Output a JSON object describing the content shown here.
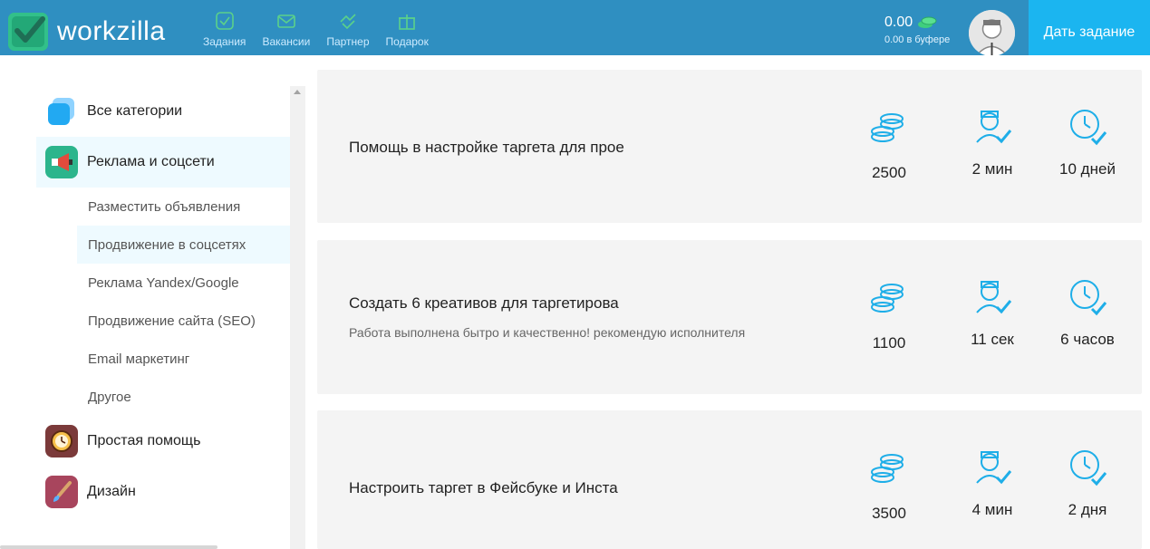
{
  "header": {
    "brand": "workzilla",
    "nav": [
      {
        "label": "Задания",
        "icon": "tasks-icon"
      },
      {
        "label": "Вакансии",
        "icon": "vacancies-icon"
      },
      {
        "label": "Партнер",
        "icon": "partner-icon"
      },
      {
        "label": "Подарок",
        "icon": "gift-icon"
      }
    ],
    "balance": "0.00",
    "balance_sub": "0.00 в буфере",
    "cta": "Дать задание"
  },
  "sidebar": {
    "categories": [
      {
        "label": "Все категории",
        "icon": "all-categories-icon",
        "color": "#3aa7f5"
      },
      {
        "label": "Реклама и соцсети",
        "icon": "megaphone-icon",
        "color": "#2cb58c",
        "active": true
      },
      {
        "label": "Простая помощь",
        "icon": "clock-icon",
        "color": "#7b3a3a"
      },
      {
        "label": "Дизайн",
        "icon": "brush-icon",
        "color": "#a8455d"
      }
    ],
    "subitems": [
      {
        "label": "Разместить объявления"
      },
      {
        "label": "Продвижение в соцсетях",
        "active": true
      },
      {
        "label": "Реклама Yandex/Google"
      },
      {
        "label": "Продвижение сайта (SEO)"
      },
      {
        "label": "Email маркетинг"
      },
      {
        "label": "Другое"
      }
    ]
  },
  "tasks": [
    {
      "title": "Помощь в настройке таргета для прое",
      "desc": "",
      "price": "2500",
      "author_time": "2 мин",
      "deadline": "10 дней"
    },
    {
      "title": "Создать 6 креативов для таргетирова",
      "desc": "Работа выполнена бытро и качественно! рекомендую исполнителя",
      "price": "1100",
      "author_time": "11 сек",
      "deadline": "6 часов"
    },
    {
      "title": "Настроить таргет в Фейсбуке и Инста",
      "desc": "",
      "price": "3500",
      "author_time": "4 мин",
      "deadline": "2 дня"
    }
  ],
  "colors": {
    "header": "#2f8fc1",
    "accent": "#1bb5f0",
    "brand_green": "#32c08a",
    "icon_blue": "#1eaee8"
  }
}
